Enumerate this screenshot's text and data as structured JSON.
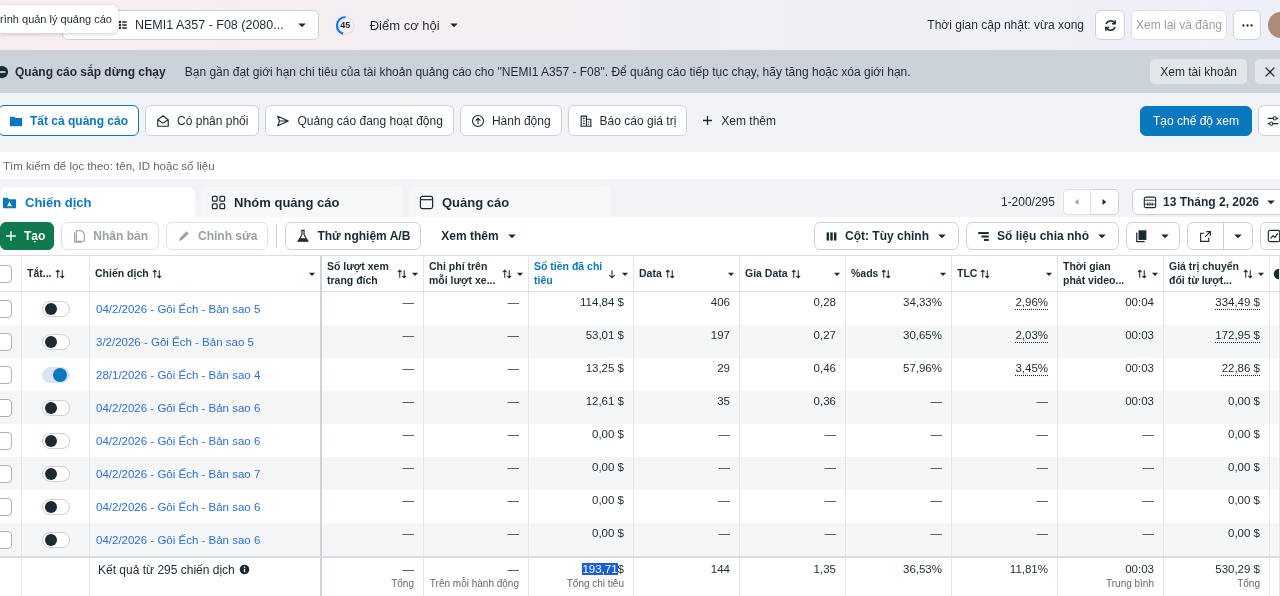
{
  "tooltip": "rình quản lý quảng cáo",
  "account": {
    "name": "NEMI1 A357 - F08 (2080..."
  },
  "opportunity": {
    "score": "45",
    "label": "Điểm cơ hội"
  },
  "updated": "Thời gian cập nhật: vừa xong",
  "review_button": {
    "label": "Xem lại và đăng",
    "disabled": true
  },
  "banner": {
    "title": "Quảng cáo sắp dừng chạy",
    "message": "Bạn gần đạt giới hạn chi tiêu của tài khoản quảng cáo cho \"NEMI1 A357 - F08\". Để quảng cáo tiếp tục chạy, hãy tăng hoặc xóa giới hạn.",
    "action": "Xem tài khoản"
  },
  "filters": [
    {
      "label": "Tất cả quảng cáo",
      "selected": true
    },
    {
      "label": "Có phân phối",
      "selected": false
    },
    {
      "label": "Quảng cáo đang hoạt động",
      "selected": false
    },
    {
      "label": "Hành động",
      "selected": false
    },
    {
      "label": "Báo cáo giá trị",
      "selected": false
    }
  ],
  "more_filters": "Xem thêm",
  "create_view": "Tạo chế độ xem",
  "search": {
    "placeholder": "Tìm kiếm để lọc theo: tên, ID hoặc số liệu"
  },
  "levels": [
    {
      "label": "Chiến dịch",
      "selected": true
    },
    {
      "label": "Nhóm quảng cáo",
      "selected": false
    },
    {
      "label": "Quảng cáo",
      "selected": false
    }
  ],
  "pagination": "1-200/295",
  "date": "13 Tháng 2, 2026",
  "toolbar": {
    "create": "Tạo",
    "actions": [
      {
        "label": "Nhân bản",
        "disabled": true
      },
      {
        "label": "Chỉnh sửa",
        "disabled": true
      },
      {
        "label": "Thử nghiệm A/B",
        "disabled": false
      }
    ],
    "more": "Xem thêm",
    "columns": "Cột: Tùy chỉnh",
    "breakdown": "Số liệu chia nhỏ"
  },
  "table": {
    "select_all": false,
    "columns": [
      {
        "label": "Tắt...",
        "sorted": false
      },
      {
        "label": "Chiến dịch",
        "sorted": false
      },
      {
        "label": "Số lượt xem trang đích",
        "sorted": false
      },
      {
        "label": "Chi phí trên mỗi lượt xe...",
        "sorted": false
      },
      {
        "label": "Số tiền đã chi tiêu",
        "sorted": true
      },
      {
        "label": "Data",
        "sorted": false
      },
      {
        "label": "Gia Data",
        "sorted": false
      },
      {
        "label": "%ads",
        "sorted": false
      },
      {
        "label": "TLC",
        "sorted": false
      },
      {
        "label": "Thời gian phát video...",
        "sorted": false
      },
      {
        "label": "Giá trị chuyển đổi từ lượt...",
        "sorted": false
      }
    ],
    "rows": [
      {
        "selected": false,
        "on": false,
        "name": "04/2/2026 - Gôi Ếch - Bản sao 5",
        "cells": [
          "—",
          "—",
          "114,84 $",
          "406",
          "0,28",
          "34,33%",
          {
            "text": "2,96%",
            "underlined": true
          },
          "00:04",
          {
            "text": "334,49 $",
            "underlined": true
          }
        ]
      },
      {
        "selected": false,
        "on": false,
        "name": "3/2/2026 - Gôi Ếch - Bản sao 5",
        "cells": [
          "—",
          "—",
          "53,01 $",
          "197",
          "0,27",
          "30,65%",
          {
            "text": "2,03%",
            "underlined": true
          },
          "00:03",
          {
            "text": "172,95 $",
            "underlined": true
          }
        ]
      },
      {
        "selected": false,
        "on": true,
        "name": "28/1/2026 - Gôi Ếch - Bản sao 4",
        "cells": [
          "—",
          "—",
          "13,25 $",
          "29",
          "0,46",
          "57,96%",
          {
            "text": "3,45%",
            "underlined": true
          },
          "00:03",
          {
            "text": "22,86 $",
            "underlined": true
          }
        ]
      },
      {
        "selected": false,
        "on": false,
        "name": "04/2/2026 - Gôi Ếch - Bản sao 6",
        "cells": [
          "—",
          "—",
          "12,61 $",
          "35",
          "0,36",
          "—",
          "—",
          "00:03",
          "0,00 $"
        ]
      },
      {
        "selected": false,
        "on": false,
        "name": "04/2/2026 - Gôi Ếch - Bản sao 6",
        "cells": [
          "—",
          "—",
          "0,00 $",
          "—",
          "—",
          "—",
          "—",
          "—",
          "0,00 $"
        ]
      },
      {
        "selected": false,
        "on": false,
        "name": "04/2/2026 - Gôi Ếch - Bản sao 7",
        "cells": [
          "—",
          "—",
          "0,00 $",
          "—",
          "—",
          "—",
          "—",
          "—",
          "0,00 $"
        ]
      },
      {
        "selected": false,
        "on": false,
        "name": "04/2/2026 - Gôi Ếch - Bản sao 6",
        "cells": [
          "—",
          "—",
          "0,00 $",
          "—",
          "—",
          "—",
          "—",
          "—",
          "0,00 $"
        ]
      },
      {
        "selected": false,
        "on": false,
        "name": "04/2/2026 - Gôi Ếch - Bản sao 6",
        "cells": [
          "—",
          "—",
          "0,00 $",
          "—",
          "—",
          "—",
          "—",
          "—",
          "0,00 $"
        ]
      }
    ],
    "footer": {
      "label": "Kết quả từ 295 chiến dịch",
      "cells": [
        {
          "value": "—",
          "note": "Tổng"
        },
        {
          "value": "—",
          "note": "Trên mỗi hành động"
        },
        {
          "value": "193,71",
          "suffix": "$",
          "highlighted": true,
          "note": "Tổng chi tiêu"
        },
        {
          "value": "144"
        },
        {
          "value": "1,35"
        },
        {
          "value": "36,53%"
        },
        {
          "value": "11,81%"
        },
        {
          "value": "00:03",
          "note": "Trung bình"
        },
        {
          "value": "530,29 $",
          "note": "Tổng"
        }
      ]
    }
  }
}
